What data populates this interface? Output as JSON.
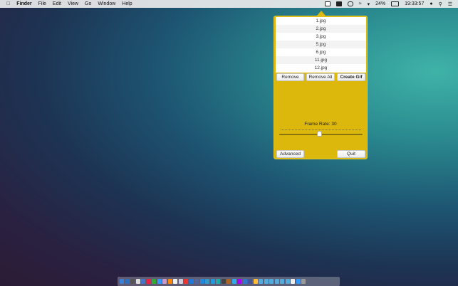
{
  "menubar": {
    "app": "Finder",
    "items": [
      "File",
      "Edit",
      "View",
      "Go",
      "Window",
      "Help"
    ],
    "battery": "24%",
    "clock": "19:33:57"
  },
  "popover": {
    "files": [
      "1.jpg",
      "2.jpg",
      "3.jpg",
      "5.jpg",
      "6.jpg",
      "11.jpg",
      "12.jpg"
    ],
    "remove": "Remove",
    "remove_all": "Remove All",
    "create_gif": "Create Gif",
    "frame_rate_label": "Frame Rate: 30",
    "frame_rate_fraction": 0.48,
    "advanced": "Advanced",
    "quit": "Quit"
  },
  "colors": {
    "popover": "#dcb70c"
  },
  "dock": {
    "icon_colors": [
      "#3b7fd9",
      "#2f6fc0",
      "#555",
      "#ddd",
      "#4477cc",
      "#e24",
      "#3a3",
      "#39f",
      "#c9c",
      "#f80",
      "#eee",
      "#ccd",
      "#e33",
      "#27d",
      "#569",
      "#28d",
      "#39c",
      "#29d",
      "#2aa",
      "#444",
      "#a62",
      "#3ae",
      "#a0f",
      "#37c",
      "#459",
      "#fb3",
      "#5ad",
      "#5ad",
      "#5ad",
      "#5ad",
      "#5ad",
      "#5ad",
      "#eee",
      "#39f",
      "#999"
    ]
  }
}
